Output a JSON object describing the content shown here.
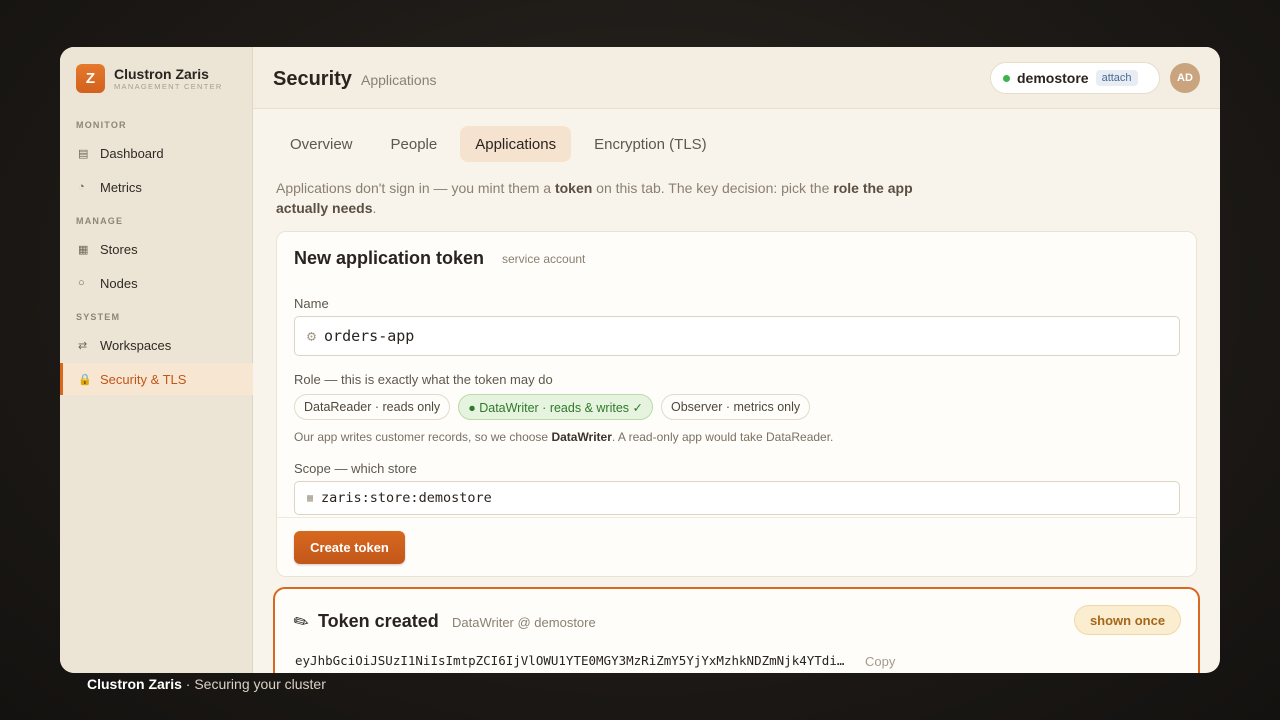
{
  "brand": {
    "logo_letter": "Z",
    "name": "Clustron Zaris",
    "subtitle": "MANAGEMENT CENTER"
  },
  "sidebar": {
    "sections": [
      {
        "label": "MONITOR"
      },
      {
        "label": "MANAGE"
      },
      {
        "label": "SYSTEM"
      }
    ],
    "items": [
      {
        "label": "Dashboard",
        "icon": "▤"
      },
      {
        "label": "Metrics",
        "icon": "◔"
      },
      {
        "label": "Stores",
        "icon": "▦"
      },
      {
        "label": "Nodes",
        "icon": "○"
      },
      {
        "label": "Workspaces",
        "icon": "⇄"
      },
      {
        "label": "Security & TLS",
        "icon": "🔒",
        "active": true
      }
    ]
  },
  "header": {
    "title": "Security",
    "subtitle": "Applications",
    "store": {
      "name": "demostore",
      "badge": "attach",
      "status_color": "#3bb44a"
    },
    "avatar_initials": "AD"
  },
  "tabs": [
    {
      "label": "Overview"
    },
    {
      "label": "People"
    },
    {
      "label": "Applications",
      "active": true
    },
    {
      "label": "Encryption (TLS)"
    }
  ],
  "intro": {
    "p1": "Applications don't sign in — you mint them a ",
    "b1": "token",
    "p2": " on this tab. The key decision: pick the ",
    "b2": "role the app actually needs",
    "p3": "."
  },
  "form": {
    "title": "New application token",
    "tag": "service account",
    "name_label": "Name",
    "name_icon": "⚙",
    "name_value": "orders-app",
    "role_label": "Role — this is exactly what the token may do",
    "roles": [
      {
        "label": "DataReader · reads only"
      },
      {
        "label": "● DataWriter · reads & writes ✓",
        "selected": true
      },
      {
        "label": "Observer · metrics only"
      }
    ],
    "hint_pre": "Our app writes customer records, so we choose ",
    "hint_bold": "DataWriter",
    "hint_post": ". A read-only app would take DataReader.",
    "scope_label": "Scope — which store",
    "scope_icon": "▦",
    "scope_value": "zaris:store:demostore",
    "submit_label": "Create token"
  },
  "token": {
    "icon": "✎",
    "title": "Token created",
    "meta": "DataWriter @ demostore",
    "badge": "shown once",
    "value": "eyJhbGciOiJSUzI1NiIsImtpZCI6IjVlOWU1YTE0MGY3MzRiZmY5YjYxMzhkNDZmNjk4YTdi…",
    "copy_label": "Copy"
  },
  "caption": {
    "brand": "Clustron Zaris",
    "text": " · Securing your cluster"
  }
}
